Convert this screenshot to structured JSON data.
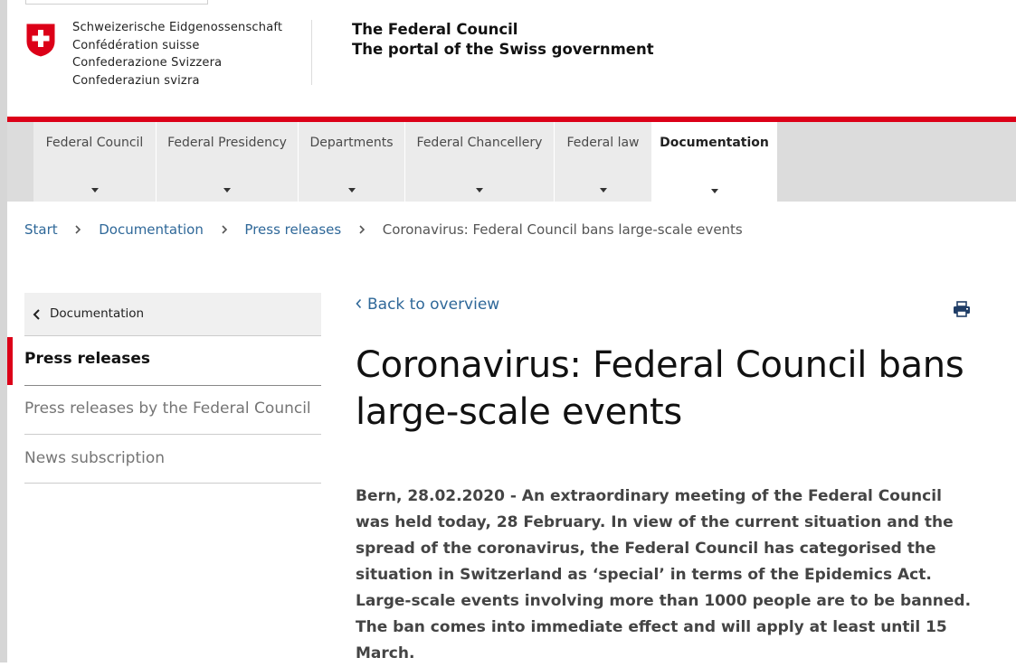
{
  "header": {
    "languages": [
      "Schweizerische Eidgenossenschaft",
      "Confédération suisse",
      "Confederazione Svizzera",
      "Confederaziun svizra"
    ],
    "portal_title_line1": "The Federal Council",
    "portal_title_line2": "The portal of the Swiss government",
    "flag_color": "#dc0018"
  },
  "nav": {
    "items": [
      {
        "label": "Federal Council"
      },
      {
        "label": "Federal Presidency"
      },
      {
        "label": "Departments"
      },
      {
        "label": "Federal Chancellery"
      },
      {
        "label": "Federal law"
      },
      {
        "label": "Documentation",
        "active": true
      }
    ],
    "accent": "#dc0018"
  },
  "breadcrumb": {
    "items": [
      "Start",
      "Documentation",
      "Press releases"
    ],
    "current": "Coronavirus: Federal Council bans large-scale events"
  },
  "sidebar": {
    "back_label": "Documentation",
    "items": [
      {
        "label": "Press releases",
        "active": true
      },
      {
        "label": "Press releases by the Federal Council"
      },
      {
        "label": "News subscription"
      }
    ]
  },
  "main": {
    "back_to_overview": "Back to overview",
    "print_icon": "printer-icon",
    "headline_line1": "Coronavirus: Federal Council bans",
    "headline_line2": "large-scale events",
    "lead": "Bern, 28.02.2020 - An extraordinary meeting of the Federal Council was held today, 28 February. In view of the current situation and the spread of the coronavirus, the Federal Council has categorised the situation in Switzerland as ‘special’ in terms of the Epidemics Act. Large-scale events involving more than 1000 people are to be banned. The ban comes into immediate effect and will apply at least until 15 March."
  }
}
